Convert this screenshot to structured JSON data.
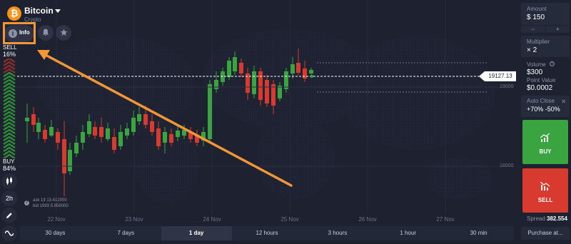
{
  "asset": {
    "name": "Bitcoin",
    "type": "Crypto",
    "logo": "₿"
  },
  "info_button": {
    "label": "Info"
  },
  "icons": {
    "bell": "bell-icon",
    "star": "star-icon"
  },
  "sentiment": {
    "sell_label": "SELL",
    "sell_pct": "16%",
    "buy_label": "BUY",
    "buy_pct": "84%",
    "sell_fraction": 0.16,
    "buy_fraction": 0.84
  },
  "tools": {
    "timeframe": "2h"
  },
  "chart": {
    "current_price": "19127.13",
    "levels": [
      "19000",
      "18000"
    ],
    "ask": "ask 19 13.412000",
    "bid": "bid 1993 5.858000",
    "dates": [
      "22 Nov",
      "23 Nov",
      "24 Nov",
      "25 Nov",
      "26 Nov",
      "27 Nov"
    ],
    "colors": {
      "up": "#39a440",
      "down": "#d93a2f",
      "annotation": "#f39637"
    }
  },
  "chart_data": {
    "type": "candlestick",
    "x_labels": [
      "22 Nov",
      "23 Nov",
      "24 Nov",
      "25 Nov",
      "26 Nov",
      "27 Nov"
    ],
    "y_ticks": [
      19000,
      18000
    ],
    "current_price": 19127.13
  },
  "timeframes": [
    "30 days",
    "7 days",
    "1 day",
    "12 hours",
    "3 hours",
    "1 hour",
    "30 min"
  ],
  "active_timeframe": "1 day",
  "panel": {
    "amount_label": "Amount",
    "amount_value": "$ 150",
    "multiplier_label": "Multiplier",
    "multiplier_value": "× 2",
    "volume_label": "Volume",
    "volume_value": "$300",
    "point_value_label": "Point Value",
    "point_value_value": "$0.0002",
    "auto_close_label": "Auto Close",
    "auto_close_value": "+70% -50%",
    "buy_label": "BUY",
    "sell_label": "SELL",
    "spread_label": "Spread",
    "spread_value": "382.554",
    "purchase_label": "Purchase at..."
  }
}
